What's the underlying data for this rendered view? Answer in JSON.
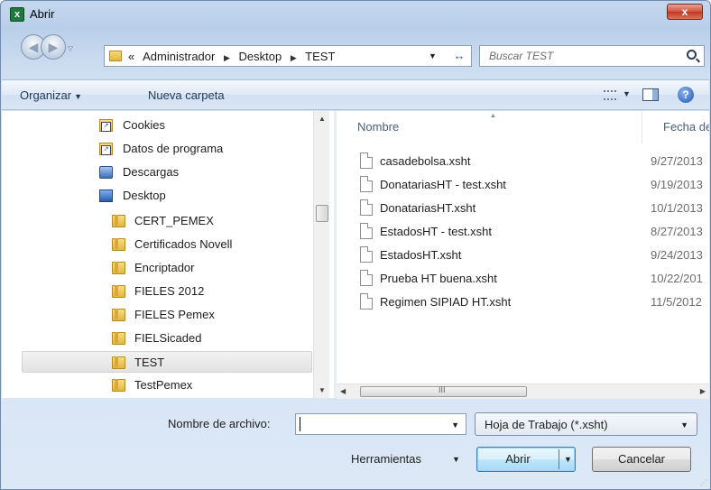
{
  "window": {
    "title": "Abrir",
    "close_label": "x"
  },
  "address": {
    "crumbs": [
      "«",
      "Administrador",
      "Desktop",
      "TEST"
    ],
    "search_placeholder": "Buscar TEST"
  },
  "toolbar": {
    "organize": "Organizar",
    "new_folder": "Nueva carpeta",
    "help": "?"
  },
  "tree": [
    {
      "label": "Cookies",
      "icon": "shortcut-folder-icon"
    },
    {
      "label": "Datos de programa",
      "icon": "shortcut-folder-icon"
    },
    {
      "label": "Descargas",
      "icon": "downloads-icon"
    },
    {
      "label": "Desktop",
      "icon": "desktop-icon"
    },
    {
      "label": "CERT_PEMEX",
      "icon": "folder-icon"
    },
    {
      "label": "Certificados Novell",
      "icon": "folder-icon"
    },
    {
      "label": "Encriptador",
      "icon": "folder-icon"
    },
    {
      "label": "FIELES 2012",
      "icon": "folder-icon"
    },
    {
      "label": "FIELES Pemex",
      "icon": "folder-icon"
    },
    {
      "label": "FIELSicaded",
      "icon": "folder-icon"
    },
    {
      "label": "TEST",
      "icon": "folder-icon",
      "selected": true
    },
    {
      "label": "TestPemex",
      "icon": "folder-icon"
    }
  ],
  "files": {
    "columns": [
      "Nombre",
      "Fecha de i"
    ],
    "rows": [
      {
        "name": "casadebolsa.xsht",
        "date": "9/27/2013"
      },
      {
        "name": "DonatariasHT - test.xsht",
        "date": "9/19/2013"
      },
      {
        "name": "DonatariasHT.xsht",
        "date": "10/1/2013"
      },
      {
        "name": "EstadosHT - test.xsht",
        "date": "8/27/2013"
      },
      {
        "name": "EstadosHT.xsht",
        "date": "9/24/2013"
      },
      {
        "name": "Prueba HT buena.xsht",
        "date": "10/22/201"
      },
      {
        "name": "Regimen SIPIAD HT.xsht",
        "date": "11/5/2012"
      }
    ]
  },
  "bottom": {
    "filename_label": "Nombre de archivo:",
    "filename_value": "",
    "filetype_value": "Hoja de Trabajo (*.xsht)",
    "tools_label": "Herramientas",
    "open_label": "Abrir",
    "cancel_label": "Cancelar"
  },
  "scroll": {
    "grip": "III"
  }
}
